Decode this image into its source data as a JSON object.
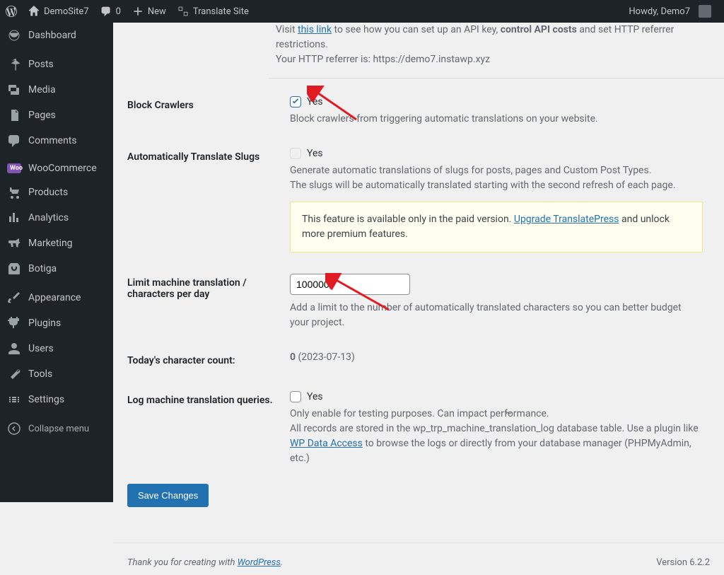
{
  "adminbar": {
    "site": "DemoSite7",
    "comments": "0",
    "new": "New",
    "translate": "Translate Site",
    "howdy": "Howdy, Demo7"
  },
  "sidebar": {
    "items": [
      {
        "label": "Dashboard"
      },
      {
        "label": "Posts"
      },
      {
        "label": "Media"
      },
      {
        "label": "Pages"
      },
      {
        "label": "Comments"
      },
      {
        "label": "WooCommerce"
      },
      {
        "label": "Products"
      },
      {
        "label": "Analytics"
      },
      {
        "label": "Marketing"
      },
      {
        "label": "Botiga"
      },
      {
        "label": "Appearance"
      },
      {
        "label": "Plugins"
      },
      {
        "label": "Users"
      },
      {
        "label": "Tools"
      },
      {
        "label": "Settings"
      }
    ],
    "collapse": "Collapse menu"
  },
  "topcut": {
    "prefix": "Visit ",
    "link": "this link",
    "mid": " to see how you can set up an API key, ",
    "bold": "control API costs",
    "rest": " and set HTTP referrer restrictions.",
    "line2": "Your HTTP referrer is: https://demo7.instawp.xyz"
  },
  "form": {
    "blockCrawlers": {
      "label": "Block Crawlers",
      "yes": "Yes",
      "desc": "Block crawlers from triggering automatic translations on your website."
    },
    "autoSlugs": {
      "label": "Automatically Translate Slugs",
      "yes": "Yes",
      "desc1": "Generate automatic translations of slugs for posts, pages and Custom Post Types.",
      "desc2": "The slugs will be automatically translated starting with the second refresh of each page.",
      "notice_pre": "This feature is available only in the paid version. ",
      "notice_link": "Upgrade TranslatePress",
      "notice_post": " and unlock more premium features."
    },
    "limit": {
      "label": "Limit machine translation / characters per day",
      "value": "1000000",
      "desc": "Add a limit to the number of automatically translated characters so you can better budget your project."
    },
    "count": {
      "label": "Today's character count:",
      "value": "0",
      "date": " (2023-07-13)"
    },
    "log": {
      "label": "Log machine translation queries.",
      "yes": "Yes",
      "desc1": "Only enable for testing purposes. Can impact performance.",
      "desc2a": "All records are stored in the wp_trp_machine_translation_log database table. Use a plugin like ",
      "desc2link": "WP Data Access",
      "desc2b": " to browse the logs or directly from your database manager (PHPMyAdmin, etc.)"
    },
    "save": "Save Changes"
  },
  "footer": {
    "thanks_pre": "Thank you for creating with ",
    "thanks_link": "WordPress",
    "thanks_post": ".",
    "version": "Version 6.2.2"
  }
}
